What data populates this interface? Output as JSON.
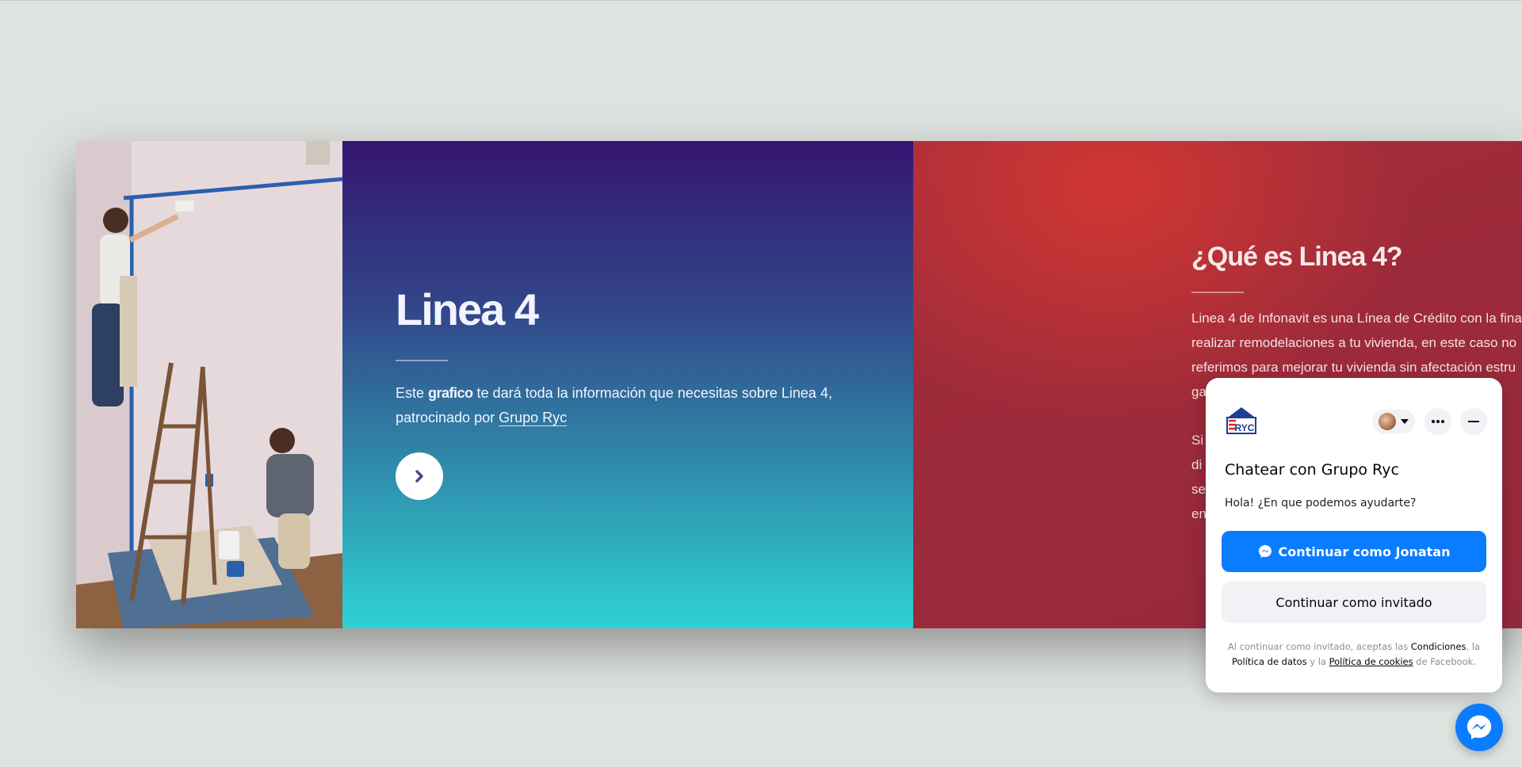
{
  "hero": {
    "title": "Linea 4",
    "desc_start": "Este ",
    "desc_bold": "grafico",
    "desc_mid": " te dará toda la información que necesitas sobre Linea 4, patrocinado por ",
    "desc_link": "Grupo Ryc"
  },
  "info": {
    "title": "¿Qué es Linea 4?",
    "paragraph1_lines": [
      "Linea 4 de Infonavit es una Línea de Crédito con la fina",
      "realizar remodelaciones a tu vivienda, en este caso no",
      "referimos para mejorar tu vivienda sin afectación estru",
      "ga"
    ],
    "paragraph2_lines": [
      "Si",
      "di",
      "se",
      "en"
    ]
  },
  "chat": {
    "logo_text": "RYC",
    "title": "Chatear con Grupo Ryc",
    "greeting": "Hola! ¿En que podemos ayudarte?",
    "primary_button": "Continuar como Jonatan",
    "secondary_button": "Continuar como invitado",
    "legal_1": "Al continuar como invitado, aceptas las ",
    "legal_terms": "Condiciones",
    "legal_2": ", la ",
    "legal_data_policy": "Política de datos",
    "legal_3": " y la ",
    "legal_cookies": "Política de cookies",
    "legal_4": " de Facebook."
  },
  "icons": {
    "arrow": "chevron-right-icon",
    "more": "more-horizontal-icon",
    "minimize": "minimize-icon",
    "messenger": "messenger-icon"
  },
  "colors": {
    "messenger_blue": "#0a7cff",
    "panel_purple": "#341571",
    "panel_teal": "#2ed2d5",
    "panel_red": "#a52d3b"
  }
}
